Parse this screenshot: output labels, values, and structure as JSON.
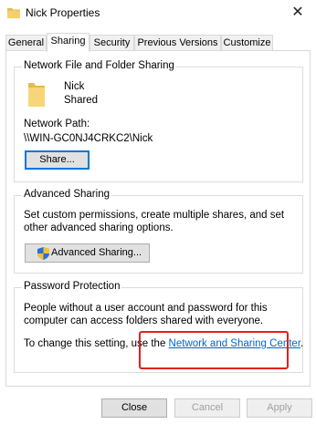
{
  "window": {
    "title": "Nick Properties",
    "close_glyph": "✕",
    "folder_icon": "folder-icon"
  },
  "tabs": [
    {
      "label": "General",
      "active": false
    },
    {
      "label": "Sharing",
      "active": true
    },
    {
      "label": "Security",
      "active": false
    },
    {
      "label": "Previous Versions",
      "active": false
    },
    {
      "label": "Customize",
      "active": false
    }
  ],
  "network_sharing": {
    "title": "Network File and Folder Sharing",
    "folder_name": "Nick",
    "status": "Shared",
    "path_label": "Network Path:",
    "path_value": "\\\\WIN-GC0NJ4CRKC2\\Nick",
    "share_button": "Share..."
  },
  "advanced_sharing": {
    "title": "Advanced Sharing",
    "description": "Set custom permissions, create multiple shares, and set other advanced sharing options.",
    "button": "Advanced Sharing..."
  },
  "password_protection": {
    "title": "Password Protection",
    "description": "People without a user account and password for this computer can access folders shared with everyone.",
    "change_prefix": "To change this setting, use the ",
    "link_text": "Network and Sharing Center",
    "change_suffix": "."
  },
  "footer": {
    "close": "Close",
    "cancel": "Cancel",
    "apply": "Apply"
  },
  "colors": {
    "accent": "#0078d7",
    "link": "#0066cc",
    "highlight": "#e0201f",
    "folder": "#e8b84b"
  }
}
